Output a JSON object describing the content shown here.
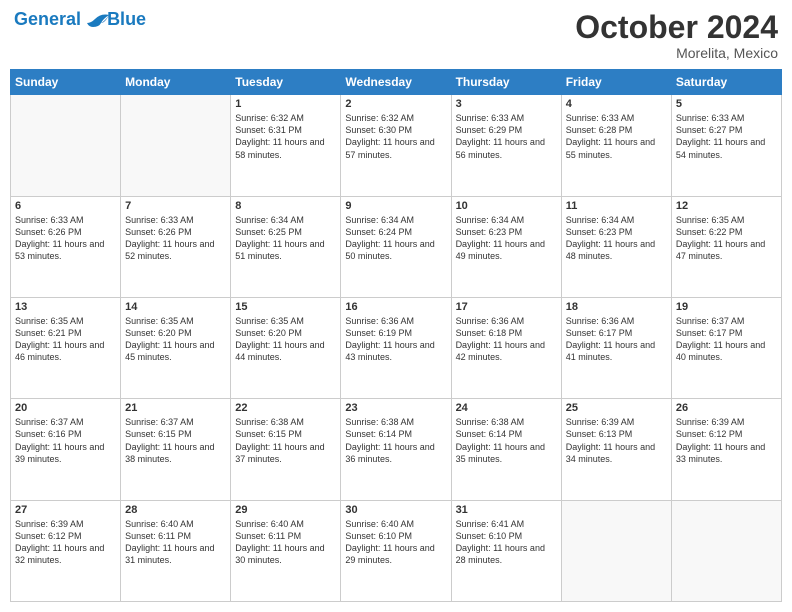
{
  "header": {
    "logo_line1": "General",
    "logo_line2": "Blue",
    "month": "October 2024",
    "location": "Morelita, Mexico"
  },
  "weekdays": [
    "Sunday",
    "Monday",
    "Tuesday",
    "Wednesday",
    "Thursday",
    "Friday",
    "Saturday"
  ],
  "weeks": [
    [
      {
        "day": "",
        "text": ""
      },
      {
        "day": "",
        "text": ""
      },
      {
        "day": "1",
        "text": "Sunrise: 6:32 AM\nSunset: 6:31 PM\nDaylight: 11 hours and 58 minutes."
      },
      {
        "day": "2",
        "text": "Sunrise: 6:32 AM\nSunset: 6:30 PM\nDaylight: 11 hours and 57 minutes."
      },
      {
        "day": "3",
        "text": "Sunrise: 6:33 AM\nSunset: 6:29 PM\nDaylight: 11 hours and 56 minutes."
      },
      {
        "day": "4",
        "text": "Sunrise: 6:33 AM\nSunset: 6:28 PM\nDaylight: 11 hours and 55 minutes."
      },
      {
        "day": "5",
        "text": "Sunrise: 6:33 AM\nSunset: 6:27 PM\nDaylight: 11 hours and 54 minutes."
      }
    ],
    [
      {
        "day": "6",
        "text": "Sunrise: 6:33 AM\nSunset: 6:26 PM\nDaylight: 11 hours and 53 minutes."
      },
      {
        "day": "7",
        "text": "Sunrise: 6:33 AM\nSunset: 6:26 PM\nDaylight: 11 hours and 52 minutes."
      },
      {
        "day": "8",
        "text": "Sunrise: 6:34 AM\nSunset: 6:25 PM\nDaylight: 11 hours and 51 minutes."
      },
      {
        "day": "9",
        "text": "Sunrise: 6:34 AM\nSunset: 6:24 PM\nDaylight: 11 hours and 50 minutes."
      },
      {
        "day": "10",
        "text": "Sunrise: 6:34 AM\nSunset: 6:23 PM\nDaylight: 11 hours and 49 minutes."
      },
      {
        "day": "11",
        "text": "Sunrise: 6:34 AM\nSunset: 6:23 PM\nDaylight: 11 hours and 48 minutes."
      },
      {
        "day": "12",
        "text": "Sunrise: 6:35 AM\nSunset: 6:22 PM\nDaylight: 11 hours and 47 minutes."
      }
    ],
    [
      {
        "day": "13",
        "text": "Sunrise: 6:35 AM\nSunset: 6:21 PM\nDaylight: 11 hours and 46 minutes."
      },
      {
        "day": "14",
        "text": "Sunrise: 6:35 AM\nSunset: 6:20 PM\nDaylight: 11 hours and 45 minutes."
      },
      {
        "day": "15",
        "text": "Sunrise: 6:35 AM\nSunset: 6:20 PM\nDaylight: 11 hours and 44 minutes."
      },
      {
        "day": "16",
        "text": "Sunrise: 6:36 AM\nSunset: 6:19 PM\nDaylight: 11 hours and 43 minutes."
      },
      {
        "day": "17",
        "text": "Sunrise: 6:36 AM\nSunset: 6:18 PM\nDaylight: 11 hours and 42 minutes."
      },
      {
        "day": "18",
        "text": "Sunrise: 6:36 AM\nSunset: 6:17 PM\nDaylight: 11 hours and 41 minutes."
      },
      {
        "day": "19",
        "text": "Sunrise: 6:37 AM\nSunset: 6:17 PM\nDaylight: 11 hours and 40 minutes."
      }
    ],
    [
      {
        "day": "20",
        "text": "Sunrise: 6:37 AM\nSunset: 6:16 PM\nDaylight: 11 hours and 39 minutes."
      },
      {
        "day": "21",
        "text": "Sunrise: 6:37 AM\nSunset: 6:15 PM\nDaylight: 11 hours and 38 minutes."
      },
      {
        "day": "22",
        "text": "Sunrise: 6:38 AM\nSunset: 6:15 PM\nDaylight: 11 hours and 37 minutes."
      },
      {
        "day": "23",
        "text": "Sunrise: 6:38 AM\nSunset: 6:14 PM\nDaylight: 11 hours and 36 minutes."
      },
      {
        "day": "24",
        "text": "Sunrise: 6:38 AM\nSunset: 6:14 PM\nDaylight: 11 hours and 35 minutes."
      },
      {
        "day": "25",
        "text": "Sunrise: 6:39 AM\nSunset: 6:13 PM\nDaylight: 11 hours and 34 minutes."
      },
      {
        "day": "26",
        "text": "Sunrise: 6:39 AM\nSunset: 6:12 PM\nDaylight: 11 hours and 33 minutes."
      }
    ],
    [
      {
        "day": "27",
        "text": "Sunrise: 6:39 AM\nSunset: 6:12 PM\nDaylight: 11 hours and 32 minutes."
      },
      {
        "day": "28",
        "text": "Sunrise: 6:40 AM\nSunset: 6:11 PM\nDaylight: 11 hours and 31 minutes."
      },
      {
        "day": "29",
        "text": "Sunrise: 6:40 AM\nSunset: 6:11 PM\nDaylight: 11 hours and 30 minutes."
      },
      {
        "day": "30",
        "text": "Sunrise: 6:40 AM\nSunset: 6:10 PM\nDaylight: 11 hours and 29 minutes."
      },
      {
        "day": "31",
        "text": "Sunrise: 6:41 AM\nSunset: 6:10 PM\nDaylight: 11 hours and 28 minutes."
      },
      {
        "day": "",
        "text": ""
      },
      {
        "day": "",
        "text": ""
      }
    ]
  ]
}
